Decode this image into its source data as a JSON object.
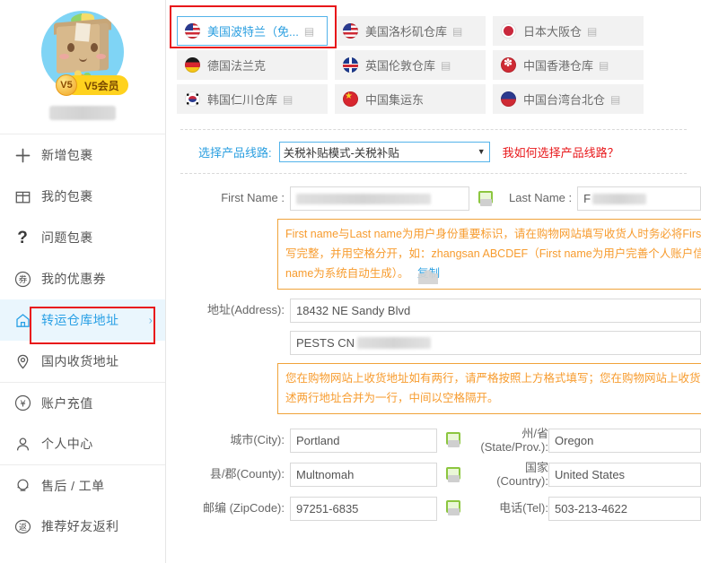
{
  "sidebar": {
    "profile": {
      "vip_level": "V5",
      "vip_label": "V5会员",
      "username_redacted": true
    },
    "items": [
      {
        "label": "新增包裹",
        "icon": "plus-icon",
        "active": false,
        "sep": false,
        "chevron": false
      },
      {
        "label": "我的包裹",
        "icon": "gift-box-icon",
        "active": false,
        "sep": false,
        "chevron": false
      },
      {
        "label": "问题包裹",
        "icon": "question-mark-icon",
        "active": false,
        "sep": false,
        "chevron": false
      },
      {
        "label": "我的优惠券",
        "icon": "coupon-icon",
        "active": false,
        "sep": false,
        "chevron": false
      },
      {
        "label": "转运仓库地址",
        "icon": "warehouse-home-icon",
        "active": true,
        "sep": false,
        "chevron": true
      },
      {
        "label": "国内收货地址",
        "icon": "map-pin-icon",
        "active": false,
        "sep": false,
        "chevron": false
      },
      {
        "label": "账户充值",
        "icon": "yuan-coin-icon",
        "active": false,
        "sep": true,
        "chevron": false
      },
      {
        "label": "个人中心",
        "icon": "user-icon",
        "active": false,
        "sep": false,
        "chevron": false
      },
      {
        "label": "售后 / 工单",
        "icon": "headset-icon",
        "active": false,
        "sep": true,
        "chevron": false
      },
      {
        "label": "推荐好友返利",
        "icon": "rebate-icon",
        "active": false,
        "sep": false,
        "chevron": false
      }
    ]
  },
  "warehouse_tabs": [
    {
      "label": "美国波特兰（免...",
      "flag": "flag-us",
      "book_icon": "book-icon",
      "selected": true
    },
    {
      "label": "美国洛杉矶仓库",
      "flag": "flag-us",
      "book_icon": "book-icon",
      "selected": false
    },
    {
      "label": "日本大阪仓",
      "flag": "flag-jp",
      "book_icon": "book-icon",
      "selected": false
    },
    {
      "label": "德国法兰克",
      "flag": "flag-de",
      "book_icon": "book-icon",
      "selected": false
    },
    {
      "label": "英国伦敦仓库",
      "flag": "flag-uk",
      "book_icon": "book-icon",
      "selected": false
    },
    {
      "label": "中国香港仓库",
      "flag": "flag-hk",
      "book_icon": "book-icon",
      "selected": false
    },
    {
      "label": "韩国仁川仓库",
      "flag": "flag-kr",
      "book_icon": "book-icon",
      "selected": false
    },
    {
      "label": "中国集运东",
      "flag": "flag-cn",
      "book_icon": "book-icon",
      "selected": false
    },
    {
      "label": "中国台湾台北仓",
      "flag": "flag-tw",
      "book_icon": "book-icon",
      "selected": false
    }
  ],
  "product_line": {
    "label": "选择产品线路:",
    "selected": "关税补贴模式-关税补贴",
    "caret_icon": "chevron-down-icon",
    "help_link": "我如何选择产品线路？"
  },
  "form": {
    "first_name": {
      "label": "First Name :",
      "value": "",
      "redacted": true,
      "copy_icon": "copy-icon"
    },
    "last_name": {
      "label": "Last Name :",
      "value": "F",
      "redacted": true
    },
    "name_warning": {
      "line1": "First name与Last name为用户身份重要标识，请在购物网站填写收货人时务必将First n",
      "line2": "写完整，并用空格分开，如：zhangsan ABCDEF（First name为用户完善个人账户信息",
      "line3": "name为系统自动生成）。",
      "copy_label": "复制"
    },
    "address": {
      "label": "地址(Address):",
      "line1": "18432 NE Sandy Blvd",
      "line2": "PESTS CN",
      "line2_redacted": true
    },
    "address_warning": {
      "line1": "您在购物网站上收货地址如有两行，请严格按照上方格式填写；您在购物网站上收货地址",
      "line2": "述两行地址合并为一行，中间以空格隔开。"
    },
    "city": {
      "label": "城市(City):",
      "value": "Portland",
      "copy_icon": "copy-icon"
    },
    "state": {
      "label_cn": "州/省",
      "label_en": "(State/Prov.):",
      "value": "Oregon"
    },
    "county": {
      "label": "县/郡(County):",
      "value": "Multnomah",
      "copy_icon": "copy-icon"
    },
    "country": {
      "label": "国家(Country):",
      "value": "United States"
    },
    "zipcode": {
      "label": "邮编 (ZipCode):",
      "value": "97251-6835",
      "copy_icon": "copy-icon"
    },
    "tel": {
      "label": "电话(Tel):",
      "value": "503-213-4622"
    }
  },
  "highlights": {
    "color": "#e8171a",
    "boxes": [
      "selected-warehouse-tab",
      "sidebar-item-warehouse-address"
    ]
  },
  "colors": {
    "accent_blue": "#2b9fe0",
    "warning_orange": "#f79c2f",
    "danger_red": "#e8171a",
    "sidebar_active_bg": "#eaf6fd",
    "tab_bg": "#f2f2f2",
    "copy_green": "#8cc63f"
  }
}
